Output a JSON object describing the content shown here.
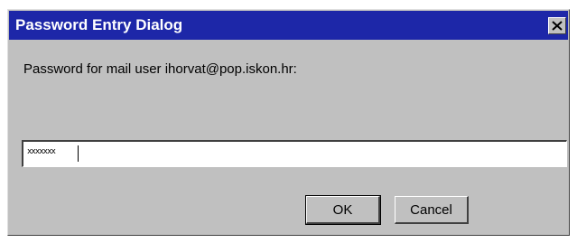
{
  "window": {
    "title": "Password Entry Dialog",
    "close_symbol": "X"
  },
  "dialog": {
    "prompt": "Password for mail user ihorvat@pop.iskon.hr:",
    "password_masked": "xxxxxxx",
    "ok_label": "OK",
    "cancel_label": "Cancel"
  },
  "icons": {
    "close": "close-icon"
  },
  "colors": {
    "titlebar": "#1d27a8",
    "title_text": "#ffffff",
    "dialog_face": "#c0c0c0",
    "field_bg": "#ffffff"
  }
}
